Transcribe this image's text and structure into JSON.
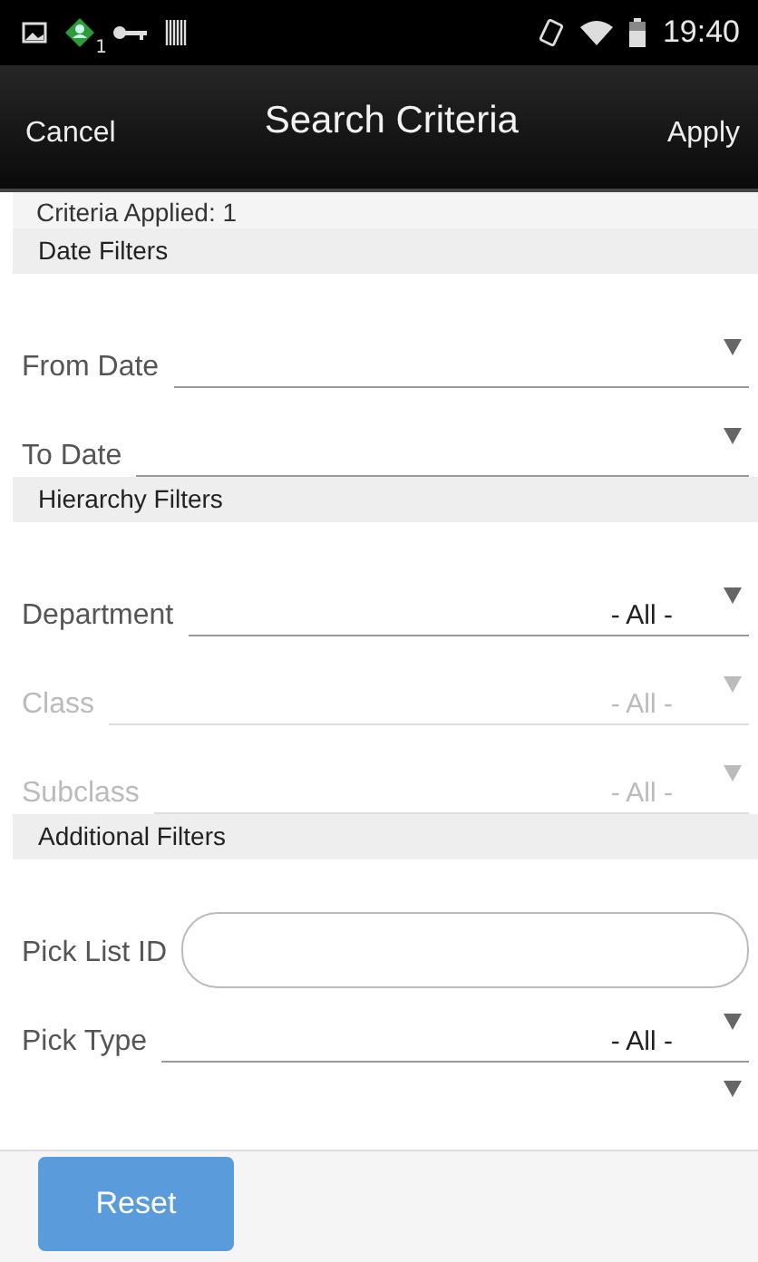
{
  "status_bar": {
    "notification_badge": "1",
    "time": "19:40"
  },
  "header": {
    "left_button": "Cancel",
    "title": "Search Criteria",
    "right_button": "Apply"
  },
  "criteria_applied": "Criteria Applied: 1",
  "sections": [
    {
      "title": "Date Filters",
      "fields": [
        {
          "kind": "select",
          "label": "From Date",
          "disabled": false
        },
        {
          "kind": "select",
          "label": "To Date",
          "disabled": false
        }
      ]
    },
    {
      "title": "Hierarchy Filters",
      "fields": [
        {
          "kind": "select",
          "label": "Department",
          "value": "- All -",
          "disabled": false
        },
        {
          "kind": "select",
          "label": "Class",
          "value": "- All -",
          "disabled": true
        },
        {
          "kind": "select",
          "label": "Subclass",
          "value": "- All -",
          "disabled": true
        }
      ]
    },
    {
      "title": "Additional Filters",
      "fields": [
        {
          "kind": "text",
          "label": "Pick List ID",
          "disabled": false
        },
        {
          "kind": "select",
          "label": "Pick Type",
          "value": "- All -",
          "disabled": false
        },
        {
          "kind": "select_hidden"
        }
      ]
    }
  ],
  "footer": {
    "reset_button": "Reset"
  }
}
